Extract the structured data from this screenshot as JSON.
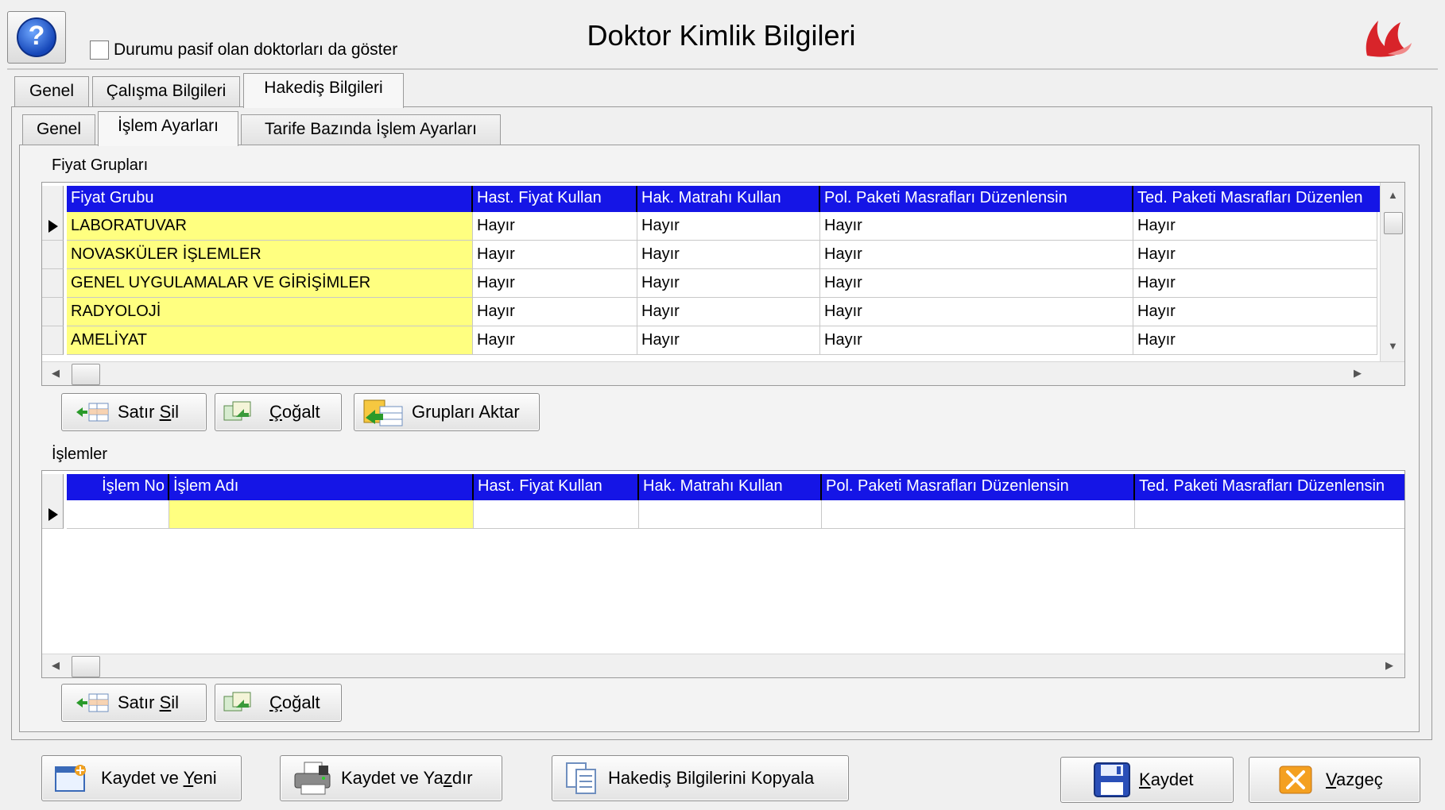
{
  "header": {
    "title": "Doktor Kimlik Bilgileri",
    "help_glyph": "?",
    "show_passive_label": "Durumu pasif olan doktorları da göster",
    "show_passive_checked": false
  },
  "tabs": [
    {
      "label": "Genel"
    },
    {
      "label": "Çalışma Bilgileri"
    },
    {
      "label": "Hakediş Bilgileri",
      "active": true
    }
  ],
  "subtabs": [
    {
      "label": "Genel"
    },
    {
      "label": "İşlem Ayarları",
      "active": true
    },
    {
      "label": "Tarife Bazında İşlem Ayarları"
    }
  ],
  "price_groups": {
    "section_label": "Fiyat Grupları",
    "columns": [
      "Fiyat Grubu",
      "Hast. Fiyat Kullan",
      "Hak. Matrahı Kullan",
      "Pol. Paketi Masrafları Düzenlensin",
      "Ted. Paketi Masrafları Düzenlen"
    ],
    "rows": [
      [
        "LABORATUVAR",
        "Hayır",
        "Hayır",
        "Hayır",
        "Hayır"
      ],
      [
        "NOVASKÜLER İŞLEMLER",
        "Hayır",
        "Hayır",
        "Hayır",
        "Hayır"
      ],
      [
        "GENEL UYGULAMALAR VE GİRİŞİMLER",
        "Hayır",
        "Hayır",
        "Hayır",
        "Hayır"
      ],
      [
        "RADYOLOJİ",
        "Hayır",
        "Hayır",
        "Hayır",
        "Hayır"
      ],
      [
        "AMELİYAT",
        "Hayır",
        "Hayır",
        "Hayır",
        "Hayır"
      ]
    ],
    "buttons": {
      "delete_row": {
        "pre": "Satır ",
        "ul": "S",
        "post": "il"
      },
      "duplicate": {
        "pre": "",
        "ul": "Ç",
        "post": "oğalt"
      },
      "transfer_groups": "Grupları Aktar"
    }
  },
  "operations": {
    "section_label": "İşlemler",
    "columns": [
      "İşlem No",
      "İşlem Adı",
      "Hast. Fiyat Kullan",
      "Hak. Matrahı Kullan",
      "Pol. Paketi Masrafları Düzenlensin",
      "Ted. Paketi Masrafları Düzenlensin"
    ],
    "rows": [
      [
        "",
        "",
        "",
        "",
        "",
        ""
      ]
    ],
    "buttons": {
      "delete_row": {
        "pre": "Satır ",
        "ul": "S",
        "post": "il"
      },
      "duplicate": {
        "pre": "",
        "ul": "Ç",
        "post": "oğalt"
      }
    }
  },
  "footer": {
    "save_new": {
      "pre": "Kaydet ve ",
      "ul": "Y",
      "post": "eni"
    },
    "save_print": {
      "pre": "Kaydet ve Ya",
      "ul": "z",
      "post": "dır"
    },
    "copy_earnings": "Hakediş Bilgilerini Kopyala",
    "save": {
      "pre": "",
      "ul": "K",
      "post": "aydet"
    },
    "cancel": {
      "pre": "",
      "ul": "V",
      "post": "azgeç"
    }
  },
  "colors": {
    "grid_header": "#1515e6",
    "key_column": "#ffff80",
    "logo": "#d8242a"
  },
  "icons": {
    "help": "help-icon",
    "logo": "flame-logo-icon",
    "delete_row": "delete-row-icon",
    "duplicate": "duplicate-icon",
    "transfer": "transfer-groups-icon",
    "save_new": "new-document-icon",
    "save_print": "printer-icon",
    "copy": "copy-document-icon",
    "save": "floppy-disk-icon",
    "cancel": "cancel-x-icon"
  }
}
